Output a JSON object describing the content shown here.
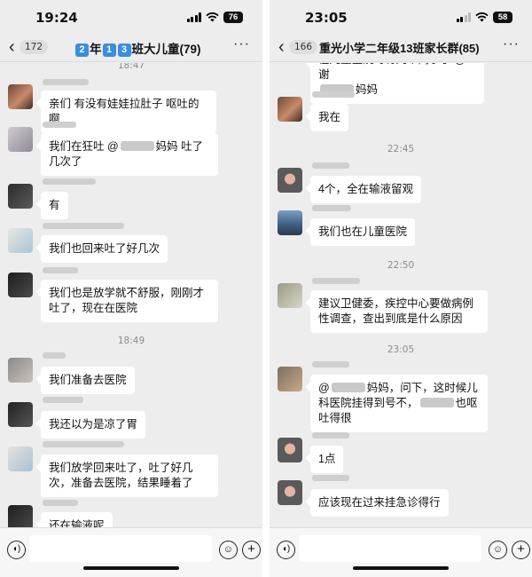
{
  "left": {
    "status": {
      "time": "19:24",
      "battery": "76"
    },
    "nav": {
      "back": "‹",
      "unread": "172",
      "title_parts": [
        "2",
        "年",
        "1",
        "3",
        "班大儿童(79)"
      ],
      "more": "···"
    },
    "timestamps": [
      "18:47",
      "18:49"
    ],
    "messages": [
      {
        "text": "亲们 有没有娃娃拉肚子 呕吐的啊"
      },
      {
        "text_before": "我们在狂吐 @",
        "text_after": "妈妈 吐了几次了"
      },
      {
        "text": "有"
      },
      {
        "text": "我们也回来吐了好几次"
      },
      {
        "text": "我们也是放学就不舒服，刚刚才吐了，现在在医院"
      },
      {
        "text": "我们准备去医院"
      },
      {
        "text": "我还以为是凉了胃"
      },
      {
        "text": "我们放学回来吐了，吐了好几次，准备去医院，结果睡着了"
      },
      {
        "text": "还在输液呢"
      }
    ],
    "icons": {
      "voice": "voice-icon",
      "emoji": "emoji-icon",
      "plus": "plus-icon"
    }
  },
  "right": {
    "status": {
      "time": "23:05",
      "battery": "58"
    },
    "nav": {
      "back": "‹",
      "unread": "166",
      "title": "重光小学二年级13班家长群(85)",
      "more": "···"
    },
    "timestamps": [
      "22:45",
      "22:50",
      "23:05"
    ],
    "messages": [
      {
        "text": "在儿童医院呀有几个同学了 @谢"
      },
      {
        "text_tail": "妈妈"
      },
      {
        "text": "我在"
      },
      {
        "text": "4个，全在输液留观"
      },
      {
        "text": "我们也在儿童医院"
      },
      {
        "text": "建议卫健委，疾控中心要做病例性调查，查出到底是什么原因"
      },
      {
        "text_before": "@",
        "text_mid": "妈妈，问下，这时候儿科医院挂得到号不，",
        "text_after": "也呕吐得很"
      },
      {
        "text": "1点"
      },
      {
        "text": "应该现在过来挂急诊得行"
      }
    ],
    "icons": {
      "voice": "voice-icon",
      "emoji": "emoji-icon",
      "plus": "plus-icon"
    }
  }
}
